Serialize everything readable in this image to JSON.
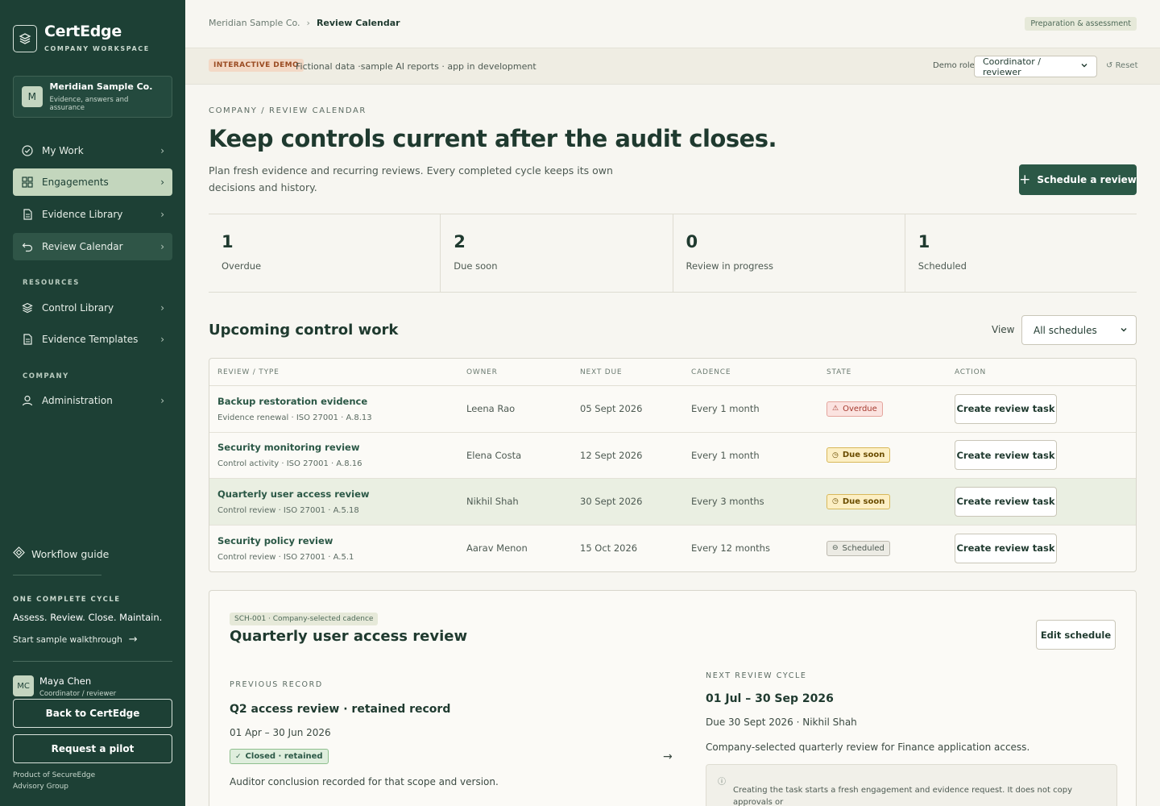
{
  "brand": {
    "name": "CertEdge",
    "subtitle": "COMPANY WORKSPACE"
  },
  "company": {
    "initial": "M",
    "name": "Meridian Sample Co.",
    "description": "Evidence, answers and assurance"
  },
  "nav": {
    "items": [
      {
        "label": "My Work",
        "icon": "check-circle-icon"
      },
      {
        "label": "Engagements",
        "icon": "grid-icon"
      },
      {
        "label": "Evidence Library",
        "icon": "document-icon"
      },
      {
        "label": "Review Calendar",
        "icon": "undo-icon"
      }
    ],
    "resources_label": "RESOURCES",
    "resources": [
      {
        "label": "Control Library",
        "icon": "layers-icon"
      },
      {
        "label": "Evidence Templates",
        "icon": "document-icon"
      }
    ],
    "company_label": "COMPANY",
    "company_items": [
      {
        "label": "Administration",
        "icon": "user-icon"
      }
    ]
  },
  "sidebar_footer": {
    "workflow_guide": "Workflow guide",
    "cycle_label": "ONE COMPLETE CYCLE",
    "cycle_text": "Assess. Review. Close. Maintain.",
    "walkthrough": "Start sample walkthrough",
    "user": {
      "initials": "MC",
      "name": "Maya Chen",
      "role": "Coordinator / reviewer"
    },
    "back_button": "Back to CertEdge",
    "pilot_button": "Request a pilot",
    "product_note": "Product of SecureEdge Advisory Group"
  },
  "topbar": {
    "breadcrumb": [
      "Meridian Sample Co.",
      "Review Calendar"
    ],
    "phase": "Preparation & assessment"
  },
  "demo": {
    "tag": "INTERACTIVE DEMO",
    "text": "Fictional data ·sample AI reports · app in development",
    "role_label": "Demo role",
    "role_value": "Coordinator / reviewer",
    "reset": "Reset"
  },
  "page": {
    "eyebrow": "COMPANY / REVIEW CALENDAR",
    "title": "Keep controls current after the audit closes.",
    "description": "Plan fresh evidence and recurring reviews. Every completed cycle keeps its own decisions and history.",
    "primary_button": "Schedule a review"
  },
  "stats": [
    {
      "value": "1",
      "label": "Overdue"
    },
    {
      "value": "2",
      "label": "Due soon"
    },
    {
      "value": "0",
      "label": "Review in progress"
    },
    {
      "value": "1",
      "label": "Scheduled"
    }
  ],
  "upcoming": {
    "title": "Upcoming control work",
    "view_label": "View",
    "view_value": "All schedules",
    "columns": [
      "REVIEW / TYPE",
      "OWNER",
      "NEXT DUE",
      "CADENCE",
      "STATE",
      "ACTION"
    ],
    "rows": [
      {
        "title": "Backup restoration evidence",
        "type": "Evidence renewal · ISO 27001 · A.8.13",
        "owner": "Leena Rao",
        "due": "05 Sept 2026",
        "cadence": "Every 1 month",
        "state": "Overdue",
        "state_kind": "overdue",
        "action": "Create review task"
      },
      {
        "title": "Security monitoring review",
        "type": "Control activity · ISO 27001 · A.8.16",
        "owner": "Elena Costa",
        "due": "12 Sept 2026",
        "cadence": "Every 1 month",
        "state": "Due soon",
        "state_kind": "due",
        "action": "Create review task"
      },
      {
        "title": "Quarterly user access review",
        "type": "Control review · ISO 27001 · A.5.18",
        "owner": "Nikhil Shah",
        "due": "30 Sept 2026",
        "cadence": "Every 3 months",
        "state": "Due soon",
        "state_kind": "due",
        "action": "Create review task"
      },
      {
        "title": "Security policy review",
        "type": "Control review · ISO 27001 · A.5.1",
        "owner": "Aarav Menon",
        "due": "15 Oct 2026",
        "cadence": "Every 12 months",
        "state": "Scheduled",
        "state_kind": "sched",
        "action": "Create review task"
      }
    ]
  },
  "detail": {
    "tag": "SCH-001 · Company-selected cadence",
    "title": "Quarterly user access review",
    "edit_button": "Edit schedule",
    "previous": {
      "caption": "PREVIOUS RECORD",
      "title": "Q2 access review · retained record",
      "dates": "01 Apr – 30 Jun 2026",
      "badge": "Closed · retained",
      "note": "Auditor conclusion recorded for that scope and version."
    },
    "next": {
      "caption": "NEXT REVIEW CYCLE",
      "dates": "01 Jul – 30 Sep 2026",
      "due": "Due 30 Sept 2026 · Nikhil Shah",
      "description": "Company-selected quarterly review for Finance application access.",
      "info": "Creating the task starts a fresh engagement and evidence request. It does not copy approvals or"
    }
  }
}
